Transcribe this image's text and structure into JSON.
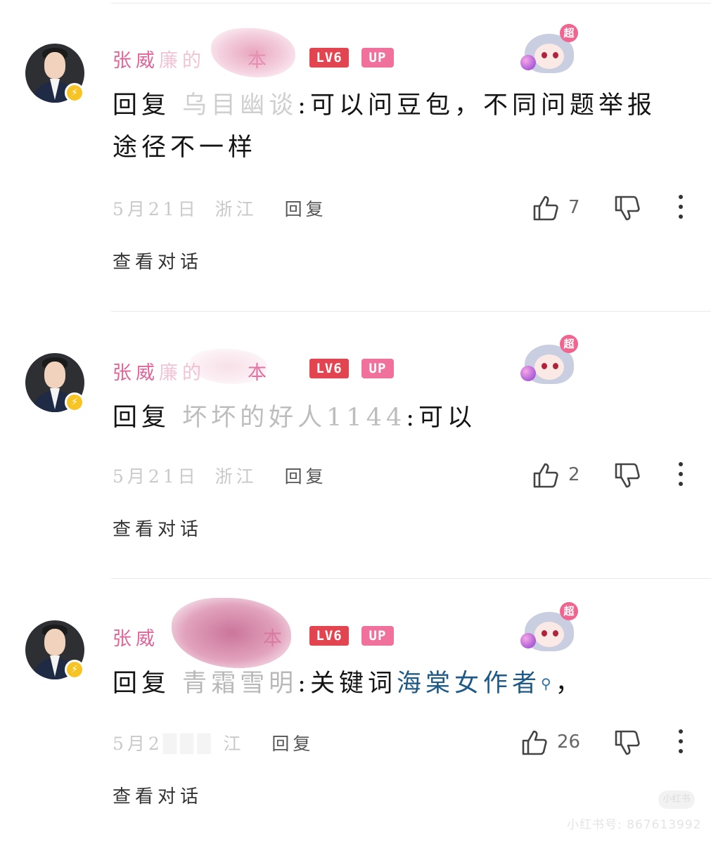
{
  "colors": {
    "username": "#e0669a",
    "lv_tag": "#e2454f",
    "up_tag": "#f0719b",
    "link": "#1f5a86",
    "vip_badge": "#f7c425"
  },
  "comments": [
    {
      "username_visible": "张威",
      "username_blurred": "廉的",
      "username_tail": "本",
      "level_tag": "LV6",
      "up_tag": "UP",
      "sticker_badge": "超",
      "reply_prefix": "回复",
      "reply_target": "乌目幽谈",
      "body": ":可以问豆包，不同问题举报途径不一样",
      "date": "5月21日",
      "location": "浙江",
      "reply_label": "回复",
      "likes": "7",
      "view_conversation": "查看对话"
    },
    {
      "username_visible": "张威",
      "username_blurred": "廉的",
      "username_tail": "本",
      "level_tag": "LV6",
      "up_tag": "UP",
      "sticker_badge": "超",
      "reply_prefix": "回复",
      "reply_target": "坏坏的好人1144",
      "body": ":可以",
      "date": "5月21日",
      "location": "浙江",
      "reply_label": "回复",
      "likes": "2",
      "view_conversation": "查看对话"
    },
    {
      "username_visible": "张威",
      "username_blurred": "",
      "username_tail": "本",
      "level_tag": "LV6",
      "up_tag": "UP",
      "sticker_badge": "超",
      "reply_prefix": "回复",
      "reply_target": "青霜雪明",
      "body": ":关键词",
      "link_text": "海棠女作者",
      "trailing": "，",
      "date": "5月2",
      "location": "江",
      "reply_label": "回复",
      "likes": "26",
      "view_conversation": "查看对话"
    }
  ],
  "watermark": {
    "logo": "小红书",
    "text": "小红书号: 867613992"
  }
}
